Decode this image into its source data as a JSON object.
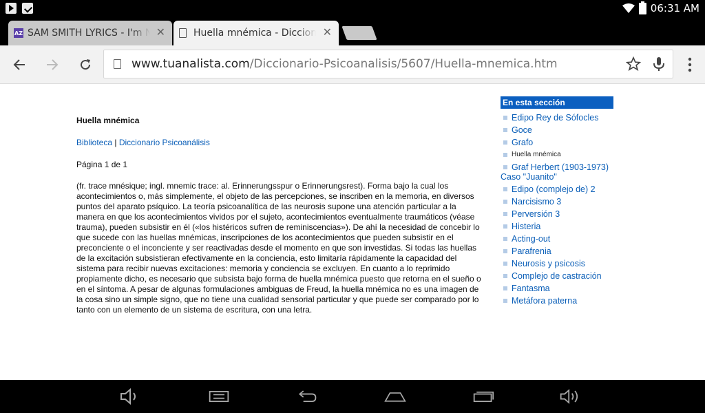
{
  "status": {
    "time": "06:31 AM"
  },
  "tabs": [
    {
      "title": "SAM SMITH LYRICS - I'm Not The Only One",
      "favicon": "AZ",
      "active": false
    },
    {
      "title": "Huella mnémica - Diccionario Psicoanálisis",
      "active": true
    }
  ],
  "toolbar": {
    "url_domain": "www.tuanalista.com",
    "url_path": "/Diccionario-Psicoanalisis/5607/Huella-mnemica.htm"
  },
  "article": {
    "title": "Huella mnémica",
    "breadcrumb": {
      "link1": "Biblioteca",
      "sep": " | ",
      "link2": "Diccionario Psicoanálisis"
    },
    "pagination": "Página 1 de 1",
    "body": "(fr. trace mnésique; ingl. mnemic trace: al. Erinnerungsspur o Erinnerungsrest). Forma bajo la cual los acontecimientos o, más simplemente, el objeto de las percepciones, se inscriben en la memoria, en diversos puntos del aparato psíquico. La teoría psicoanalítica de las neurosis supone una atención particular a la manera en que los acontecimientos vividos por el sujeto, acontecimientos eventualmente traumáticos (véase trauma), pueden subsistir en él («los histéricos sufren de reminiscencias»). De ahí la necesidad de concebir lo que sucede con las huellas mnémicas, inscripciones de los acontecimientos que pueden subsistir en el preconciente o el inconciente y ser reactivadas desde el momento en que son investidas. Si todas las huellas de la excitación subsistieran efectivamente en la conciencia, esto limitaría rápidamente la capacidad del sistema para recibir nuevas excitaciones: memoria y conciencia se excluyen. En cuanto a lo reprimido propiamente dicho, es necesario que subsista bajo forma de huella mnémica puesto que retorna en el sueño o en el síntoma. A pesar de algunas formulaciones ambiguas de Freud, la huella mnémica no es una imagen de la cosa sino un simple signo, que no tiene una cualidad sensorial particular y que puede ser comparado por lo tanto con un elemento de un sistema de escritura, con una letra."
  },
  "sidebar": {
    "heading": "En esta sección",
    "items": [
      {
        "label": "Edipo Rey de Sófocles"
      },
      {
        "label": "Goce"
      },
      {
        "label": "Grafo"
      },
      {
        "label": "Huella mnémica"
      },
      {
        "label": "Graf Herbert (1903-1973) Caso \"Juanito\""
      },
      {
        "label": "Edipo (complejo de) 2"
      },
      {
        "label": "Narcisismo 3"
      },
      {
        "label": "Perversión 3"
      },
      {
        "label": "Histeria"
      },
      {
        "label": "Acting-out"
      },
      {
        "label": "Parafrenia"
      },
      {
        "label": "Neurosis y psicosis"
      },
      {
        "label": "Complejo de castración"
      },
      {
        "label": "Fantasma"
      },
      {
        "label": "Metáfora paterna"
      }
    ]
  },
  "icons": {
    "status_left": [
      "play-store-icon",
      "shopping-bag-icon"
    ],
    "status_right": [
      "wifi-icon",
      "battery-icon"
    ],
    "toolbar": [
      "back-icon",
      "forward-icon",
      "reload-icon",
      "page-icon",
      "star-icon",
      "mic-icon",
      "menu-icon"
    ],
    "navbar": [
      "volume-down-icon",
      "screenshot-icon",
      "back-icon",
      "home-icon",
      "recents-icon",
      "volume-up-icon"
    ]
  },
  "colors": {
    "link": "#0b5fb8",
    "sidebar_header": "#0b5fc0"
  }
}
